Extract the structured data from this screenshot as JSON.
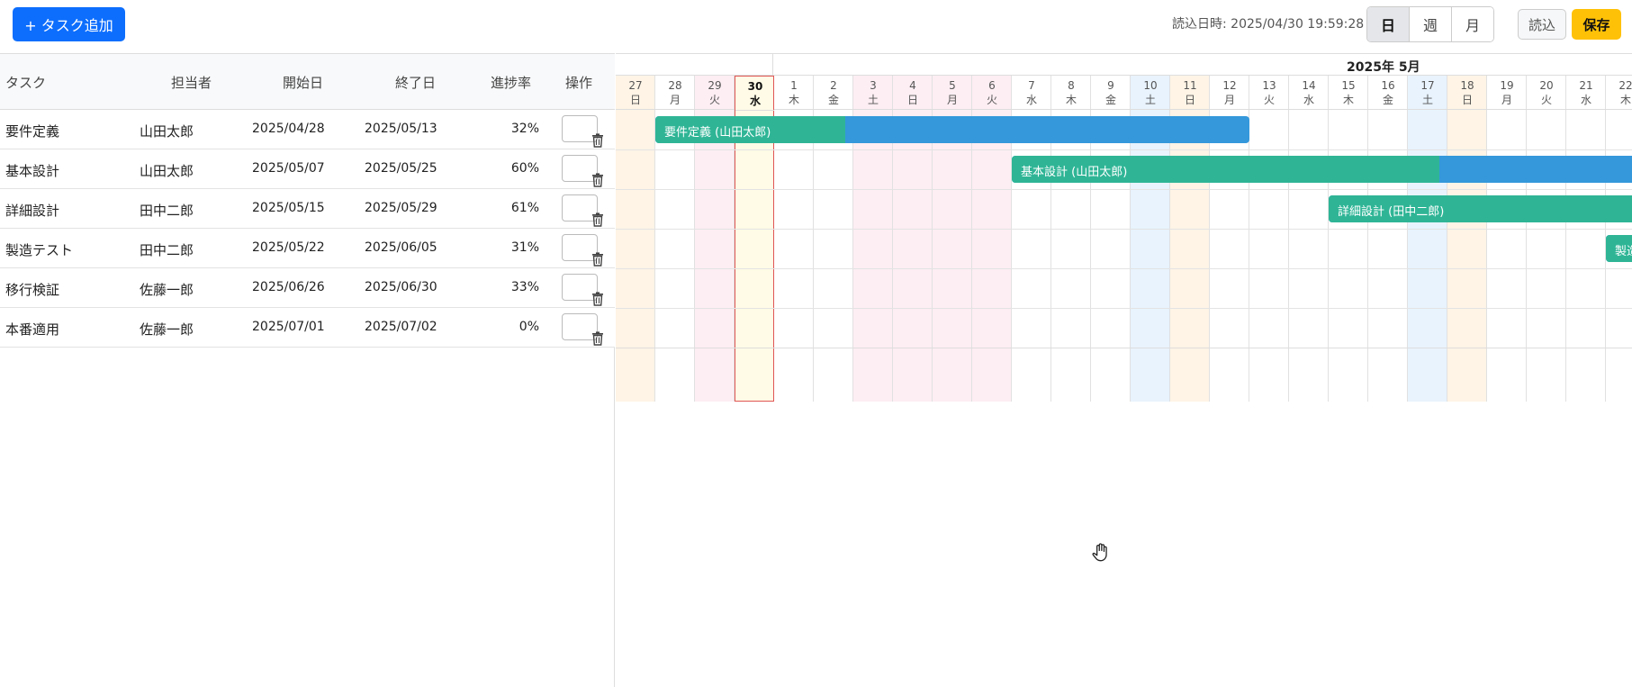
{
  "toolbar": {
    "add_task_label": "+ タスク追加",
    "import_info": "読込日時: 2025/04/30 19:59:28",
    "views": [
      "日",
      "週",
      "月"
    ],
    "active_view": "日",
    "load_label": "読込",
    "save_label": "保存"
  },
  "task_table": {
    "headers": {
      "task": "タスク",
      "assignee": "担当者",
      "start": "開始日",
      "end": "終了日",
      "progress": "進捗率",
      "actions": "操作"
    },
    "delete_icon": "trash-icon",
    "rows": [
      {
        "task": "要件定義",
        "assignee": "山田太郎",
        "start": "2025/04/28",
        "end": "2025/05/13",
        "progress": "32%",
        "progress_value": 0.32
      },
      {
        "task": "基本設計",
        "assignee": "山田太郎",
        "start": "2025/05/07",
        "end": "2025/05/25",
        "progress": "60%",
        "progress_value": 0.6
      },
      {
        "task": "詳細設計",
        "assignee": "田中二郎",
        "start": "2025/05/15",
        "end": "2025/05/29",
        "progress": "61%",
        "progress_value": 0.61
      },
      {
        "task": "製造テスト",
        "assignee": "田中二郎",
        "start": "2025/05/22",
        "end": "2025/06/05",
        "progress": "31%",
        "progress_value": 0.31
      },
      {
        "task": "移行検証",
        "assignee": "佐藤一郎",
        "start": "2025/06/26",
        "end": "2025/06/30",
        "progress": "33%",
        "progress_value": 0.33
      },
      {
        "task": "本番適用",
        "assignee": "佐藤一郎",
        "start": "2025/07/01",
        "end": "2025/07/02",
        "progress": "0%",
        "progress_value": 0.0
      }
    ]
  },
  "gantt": {
    "month_label": "2025年 5月",
    "today": "30",
    "days": [
      {
        "d": "27",
        "w": "日",
        "bg": "#fff4e6"
      },
      {
        "d": "28",
        "w": "月",
        "bg": "#ffffff"
      },
      {
        "d": "29",
        "w": "火",
        "bg": "#fdeef3"
      },
      {
        "d": "30",
        "w": "水",
        "bg": "#fffbe6"
      },
      {
        "d": "1",
        "w": "木",
        "bg": "#ffffff"
      },
      {
        "d": "2",
        "w": "金",
        "bg": "#ffffff"
      },
      {
        "d": "3",
        "w": "土",
        "bg": "#fdeef3"
      },
      {
        "d": "4",
        "w": "日",
        "bg": "#fdeef3"
      },
      {
        "d": "5",
        "w": "月",
        "bg": "#fdeef3"
      },
      {
        "d": "6",
        "w": "火",
        "bg": "#fdeef3"
      },
      {
        "d": "7",
        "w": "水",
        "bg": "#ffffff"
      },
      {
        "d": "8",
        "w": "木",
        "bg": "#ffffff"
      },
      {
        "d": "9",
        "w": "金",
        "bg": "#ffffff"
      },
      {
        "d": "10",
        "w": "土",
        "bg": "#e8f3fd"
      },
      {
        "d": "11",
        "w": "日",
        "bg": "#fff4e6"
      },
      {
        "d": "12",
        "w": "月",
        "bg": "#ffffff"
      },
      {
        "d": "13",
        "w": "火",
        "bg": "#ffffff"
      },
      {
        "d": "14",
        "w": "水",
        "bg": "#ffffff"
      },
      {
        "d": "15",
        "w": "木",
        "bg": "#ffffff"
      },
      {
        "d": "16",
        "w": "金",
        "bg": "#ffffff"
      },
      {
        "d": "17",
        "w": "土",
        "bg": "#e8f3fd"
      },
      {
        "d": "18",
        "w": "日",
        "bg": "#fff4e6"
      },
      {
        "d": "19",
        "w": "月",
        "bg": "#ffffff"
      },
      {
        "d": "20",
        "w": "火",
        "bg": "#ffffff"
      },
      {
        "d": "21",
        "w": "水",
        "bg": "#ffffff"
      },
      {
        "d": "22",
        "w": "木",
        "bg": "#ffffff"
      }
    ],
    "bars": [
      {
        "label": "要件定義 (山田太郎)",
        "start_index": 1,
        "end_index": 16,
        "progress": 0.32
      },
      {
        "label": "基本設計 (山田太郎)",
        "start_index": 10,
        "end_index": 28,
        "progress": 0.6
      },
      {
        "label": "詳細設計 (田中二郎)",
        "start_index": 18,
        "end_index": 32,
        "progress": 0.61
      },
      {
        "label": "製造テスト (田中二郎)",
        "start_index": 25,
        "end_index": 39,
        "progress": 0.31
      }
    ],
    "colors": {
      "progress_fill": "#2fb596",
      "remaining": "#3498db",
      "today_border": "#e05555"
    }
  },
  "cursor": "hand-cursor-icon"
}
